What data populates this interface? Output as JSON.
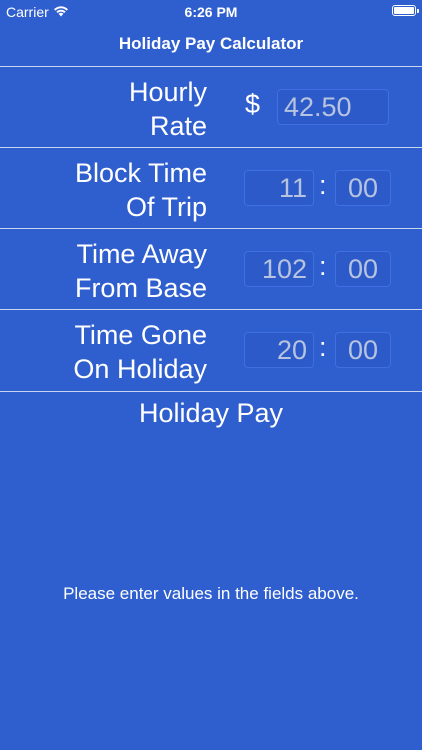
{
  "status_bar": {
    "carrier": "Carrier",
    "time": "6:26 PM",
    "wifi_icon": "wifi-icon",
    "battery_icon": "battery-icon"
  },
  "nav": {
    "title": "Holiday Pay Calculator"
  },
  "rows": {
    "hourly_rate": {
      "label_line1": "Hourly",
      "label_line2": "Rate",
      "currency": "$",
      "placeholder": "42.50"
    },
    "block_time": {
      "label_line1": "Block Time",
      "label_line2": "Of Trip",
      "hours_placeholder": "11",
      "minutes_placeholder": "00",
      "separator": ":"
    },
    "time_away": {
      "label_line1": "Time Away",
      "label_line2": "From Base",
      "hours_placeholder": "102",
      "minutes_placeholder": "00",
      "separator": ":"
    },
    "time_gone": {
      "label_line1": "Time Gone",
      "label_line2": "On Holiday",
      "hours_placeholder": "20",
      "minutes_placeholder": "00",
      "separator": ":"
    }
  },
  "result": {
    "title": "Holiday Pay",
    "message": "Please enter values in the fields above."
  },
  "colors": {
    "background": "#2f5fce",
    "text": "#ffffff",
    "placeholder": "#b7c3df",
    "divider": "#c9d6f2"
  }
}
